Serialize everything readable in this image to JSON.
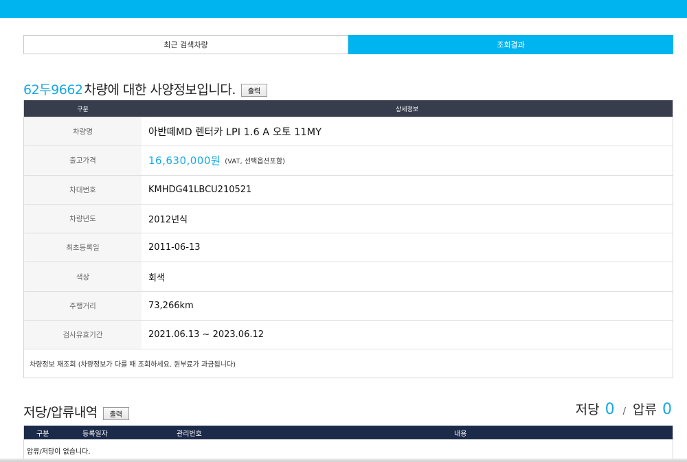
{
  "tabs": {
    "recent": "최근 검색차량",
    "result": "조회결과"
  },
  "spec": {
    "plate": "62두9662",
    "title_rest": "차량에 대한 사양정보입니다.",
    "print_label": "출력",
    "header": {
      "col1": "구분",
      "col2": "상세정보"
    },
    "rows": [
      {
        "label": "차량명",
        "value": "아반떼MD 렌터카 LPI 1.6 A 오토 11MY"
      },
      {
        "label": "출고가격",
        "value": "16,630,000원",
        "note": "(VAT, 선택옵션포함)"
      },
      {
        "label": "차대번호",
        "value": "KMHDG41LBCU210521"
      },
      {
        "label": "차량년도",
        "value": "2012년식"
      },
      {
        "label": "최초등록일",
        "value": "2011-06-13"
      },
      {
        "label": "색상",
        "value": "회색"
      },
      {
        "label": "주행거리",
        "value": "73,266km"
      },
      {
        "label": "검사유효기간",
        "value": "2021.06.13 ~ 2023.06.12"
      }
    ],
    "footer_note": "차량정보 재조회 (차량정보가 다를 때 조회하세요. 원부료가 과금됩니다)"
  },
  "lien": {
    "title": "저당/압류내역",
    "print_label": "출력",
    "counts": {
      "mortgage_label": "저당",
      "mortgage_count": "0",
      "separator": "/",
      "seizure_label": "압류",
      "seizure_count": "0"
    },
    "header": {
      "col1": "구분",
      "col2": "등록일자",
      "col3": "관리번호",
      "col4": "내용"
    },
    "empty_message": "압류/저당이 없습니다."
  },
  "colors": {
    "accent": "#00b4f0",
    "highlight_text": "#17a8e3",
    "table_header": "#373d4c",
    "lien_header": "#1c2a4a"
  }
}
